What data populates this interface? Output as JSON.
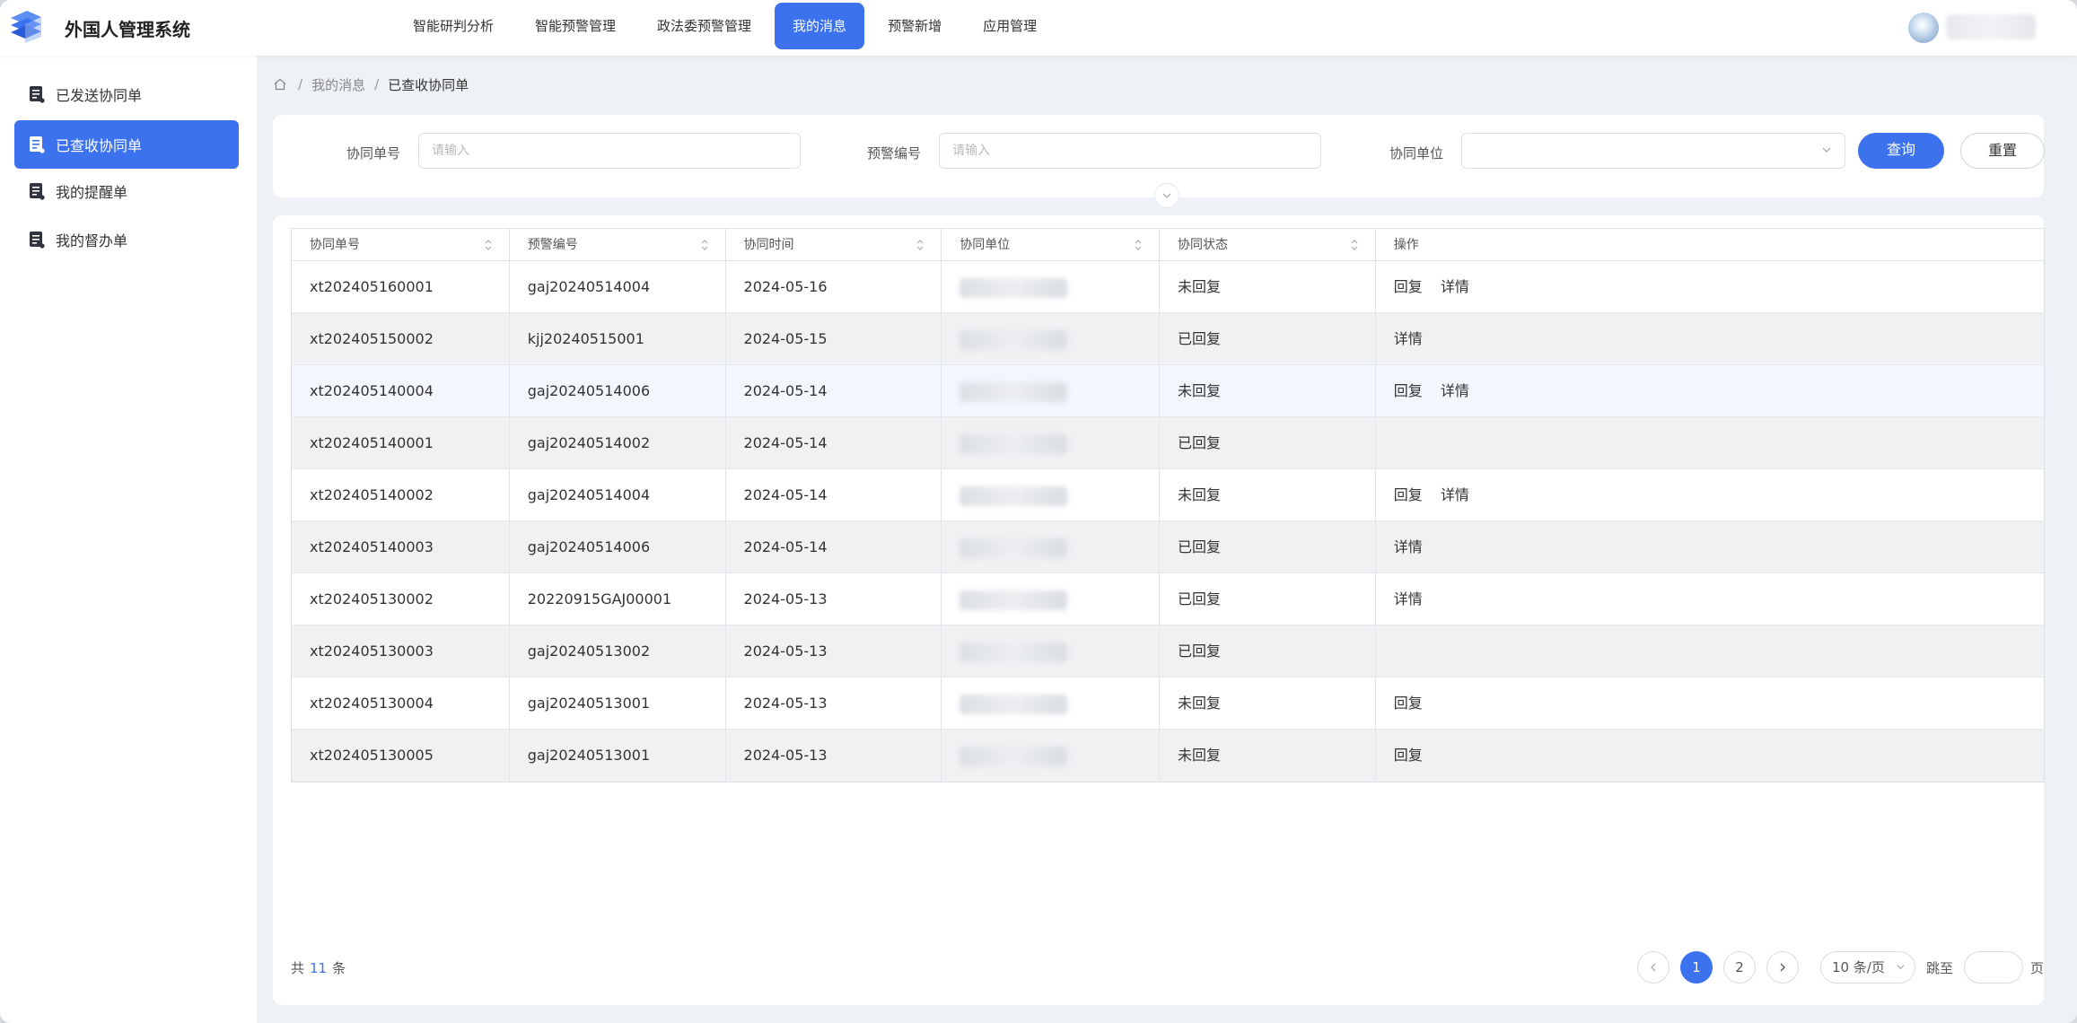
{
  "app": {
    "title": "外国人管理系统",
    "brand_color": "#3d72ef"
  },
  "nav": {
    "items": [
      {
        "label": "智能研判分析",
        "active": false
      },
      {
        "label": "智能预警管理",
        "active": false
      },
      {
        "label": "政法委预警管理",
        "active": false
      },
      {
        "label": "我的消息",
        "active": true
      },
      {
        "label": "预警新增",
        "active": false
      },
      {
        "label": "应用管理",
        "active": false
      }
    ]
  },
  "sidebar": {
    "items": [
      {
        "label": "已发送协同单",
        "active": false
      },
      {
        "label": "已查收协同单",
        "active": true
      },
      {
        "label": "我的提醒单",
        "active": false
      },
      {
        "label": "我的督办单",
        "active": false
      }
    ]
  },
  "breadcrumb": {
    "home_icon": "home-icon",
    "parent": "我的消息",
    "separator": "/",
    "current": "已查收协同单"
  },
  "search": {
    "fields": [
      {
        "label": "协同单号",
        "placeholder": "请输入"
      },
      {
        "label": "预警编号",
        "placeholder": "请输入"
      },
      {
        "label": "协同单位",
        "placeholder": ""
      }
    ],
    "query_label": "查询",
    "reset_label": "重置"
  },
  "table": {
    "columns": [
      "协同单号",
      "预警编号",
      "协同时间",
      "协同单位",
      "协同状态",
      "操作"
    ],
    "rows": [
      {
        "id": "xt202405160001",
        "warning": "gaj20240514004",
        "date": "2024-05-16",
        "status": "未回复",
        "actions": [
          "回复",
          "详情"
        ]
      },
      {
        "id": "xt202405150002",
        "warning": "kjj20240515001",
        "date": "2024-05-15",
        "status": "已回复",
        "actions": [
          "详情"
        ]
      },
      {
        "id": "xt202405140004",
        "warning": "gaj20240514006",
        "date": "2024-05-14",
        "status": "未回复",
        "actions": [
          "回复",
          "详情"
        ]
      },
      {
        "id": "xt202405140001",
        "warning": "gaj20240514002",
        "date": "2024-05-14",
        "status": "已回复",
        "actions": []
      },
      {
        "id": "xt202405140002",
        "warning": "gaj20240514004",
        "date": "2024-05-14",
        "status": "未回复",
        "actions": [
          "回复",
          "详情"
        ]
      },
      {
        "id": "xt202405140003",
        "warning": "gaj20240514006",
        "date": "2024-05-14",
        "status": "已回复",
        "actions": [
          "详情"
        ]
      },
      {
        "id": "xt202405130002",
        "warning": "20220915GAJ00001",
        "date": "2024-05-13",
        "status": "已回复",
        "actions": [
          "详情"
        ]
      },
      {
        "id": "xt202405130003",
        "warning": "gaj20240513002",
        "date": "2024-05-13",
        "status": "已回复",
        "actions": []
      },
      {
        "id": "xt202405130004",
        "warning": "gaj20240513001",
        "date": "2024-05-13",
        "status": "未回复",
        "actions": [
          "回复"
        ]
      },
      {
        "id": "xt202405130005",
        "warning": "gaj20240513001",
        "date": "2024-05-13",
        "status": "未回复",
        "actions": [
          "回复"
        ]
      }
    ]
  },
  "pagination": {
    "total_prefix": "共",
    "total_count": "11",
    "total_suffix": "条",
    "pages": [
      "1",
      "2"
    ],
    "current_page": "1",
    "page_size": "10 条/页",
    "jump_label": "跳至",
    "page_unit": "页"
  }
}
